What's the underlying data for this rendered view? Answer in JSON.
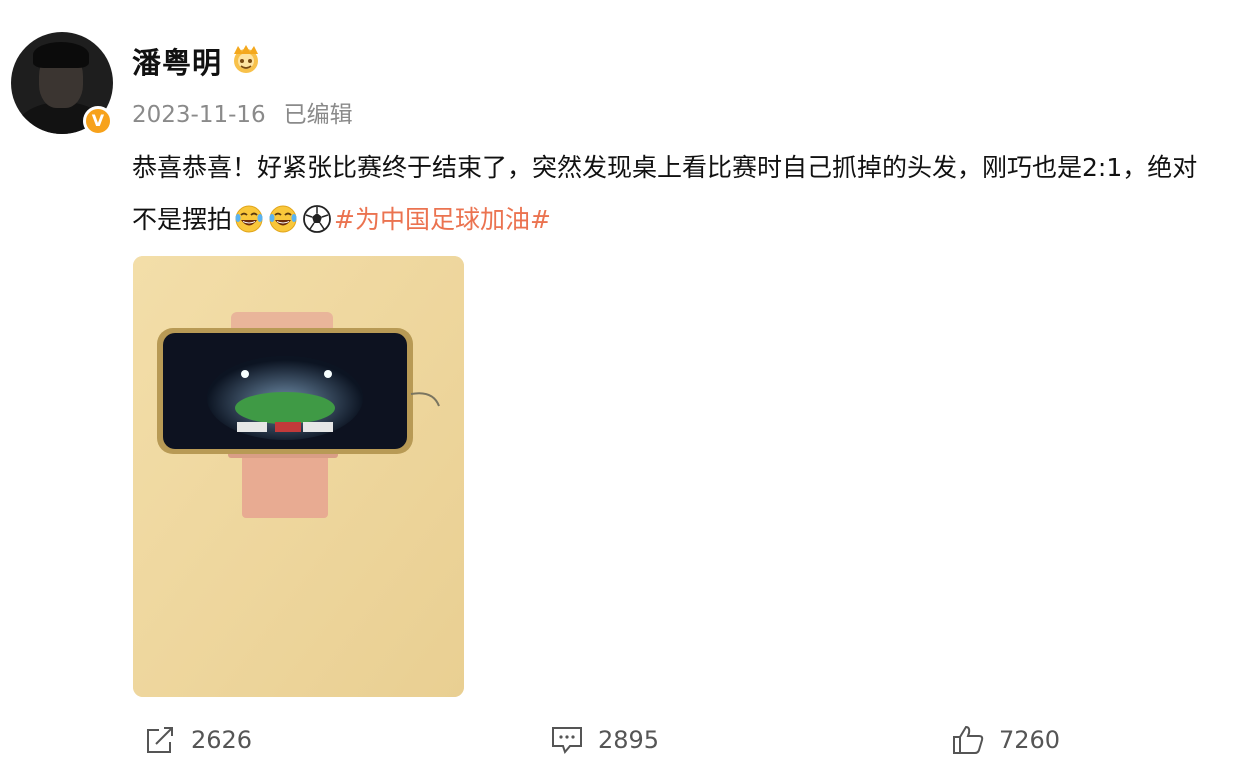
{
  "post": {
    "username": "潘粤明",
    "date": "2023-11-16",
    "edited_label": "已编辑",
    "text_part1": "恭喜恭喜！好紧张比赛终于结束了，突然发现桌上看比赛时自己抓掉的头发，刚巧也是2:1，绝对不是摆拍",
    "emojis": [
      "laugh-cry-icon",
      "laugh-cry-icon",
      "soccer-ball-icon"
    ],
    "hashtag": "#为中国足球加油#",
    "hashtag_color": "#eb7350"
  },
  "actions": {
    "repost_count": "2626",
    "comment_count": "2895",
    "like_count": "7260"
  }
}
